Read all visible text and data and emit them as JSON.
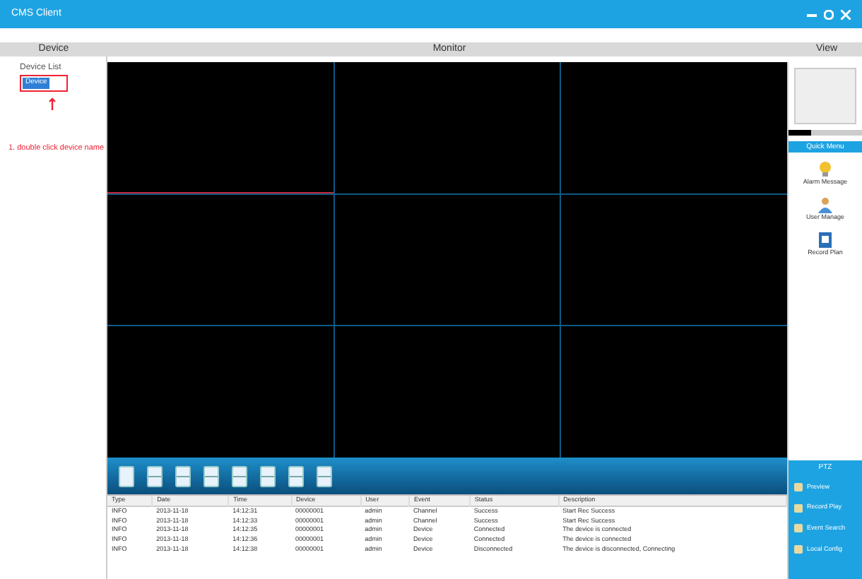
{
  "window": {
    "title": "CMS Client"
  },
  "header": {
    "left": "Device",
    "center": "Monitor",
    "right": "View"
  },
  "tree": {
    "root": "Device List",
    "children": [
      {
        "label": "Device",
        "selected": true
      }
    ]
  },
  "annotation": "1. double click device name",
  "video": {
    "windows": [
      {
        "selected": true
      },
      {
        "selected": false
      },
      {
        "selected": false
      },
      {
        "selected": false
      },
      {
        "selected": false
      },
      {
        "selected": false
      },
      {
        "selected": false
      },
      {
        "selected": false
      },
      {
        "selected": false
      }
    ]
  },
  "toolbar": {
    "buttons": [
      {
        "kind": "single"
      },
      {
        "kind": "split"
      },
      {
        "kind": "split"
      },
      {
        "kind": "split"
      },
      {
        "kind": "split"
      },
      {
        "kind": "split"
      },
      {
        "kind": "split"
      },
      {
        "kind": "split"
      }
    ]
  },
  "log": {
    "columns": [
      "Type",
      "Date",
      "Time",
      "Device",
      "User",
      "Event",
      "Status",
      "Description"
    ],
    "rows": [
      [
        "INFO",
        "2013-11-18",
        "14:12:31",
        "00000001",
        "admin",
        "Channel",
        "Success",
        "Start Rec Success"
      ],
      [
        "INFO",
        "2013-11-18",
        "14:12:33",
        "00000001",
        "admin",
        "Channel",
        "Success",
        "Start Rec Success"
      ],
      [
        "INFO",
        "2013-11-18",
        "14:12:35",
        "00000001",
        "admin",
        "Device",
        "Connected",
        "The device is connected"
      ],
      [
        "INFO",
        "2013-11-18",
        "14:12:36",
        "00000001",
        "admin",
        "Device",
        "Connected",
        "The device is connected"
      ],
      [
        "INFO",
        "2013-11-18",
        "14:12:38",
        "00000001",
        "admin",
        "Device",
        "Disconnected",
        "The device is disconnected, Connecting"
      ]
    ]
  },
  "right_panel": {
    "title": "Quick Menu",
    "items": [
      "Alarm Message",
      "User Manage",
      "Record Plan"
    ]
  },
  "bottom_menu": {
    "title": "PTZ",
    "items": [
      "Preview",
      "Record Play",
      "Event Search",
      "Local Config"
    ]
  }
}
